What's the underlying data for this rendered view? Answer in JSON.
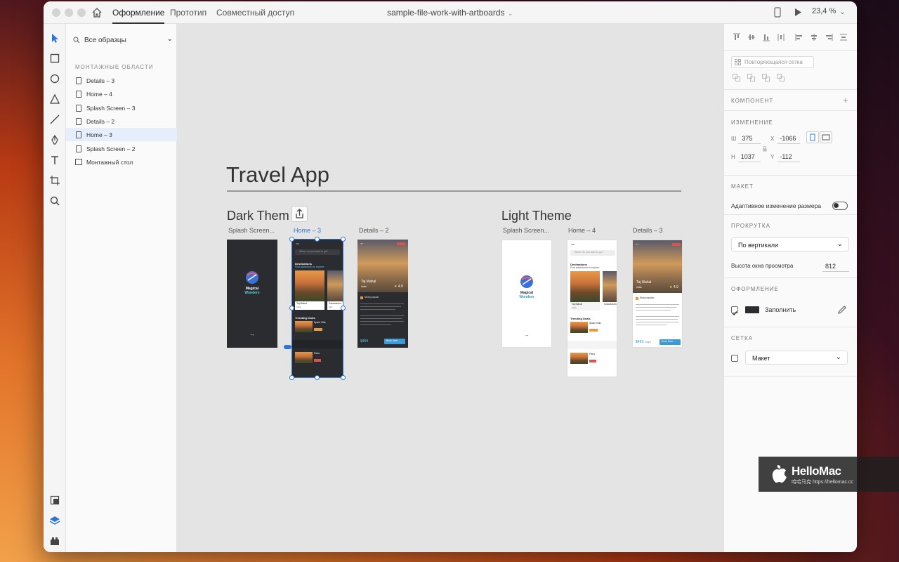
{
  "titlebar": {
    "tabs": [
      "Оформление",
      "Прототип",
      "Совместный доступ"
    ],
    "doc_title": "sample-file-work-with-artboards",
    "zoom": "23,4 %"
  },
  "layers": {
    "sample_select": "Все образцы",
    "section_label": "МОНТАЖНЫЕ ОБЛАСТИ",
    "items": [
      {
        "label": "Details – 3"
      },
      {
        "label": "Home – 4"
      },
      {
        "label": "Splash Screen – 3"
      },
      {
        "label": "Details – 2"
      },
      {
        "label": "Home – 3"
      },
      {
        "label": "Splash Screen – 2"
      },
      {
        "label": "Монтажный стол"
      }
    ],
    "selected_index": 4
  },
  "canvas": {
    "title": "Travel App",
    "dark_theme_title": "Dark Them",
    "light_theme_title": "Light Theme",
    "artboards": [
      {
        "label": "Splash Screen..."
      },
      {
        "label": "Home – 3"
      },
      {
        "label": "Details – 2"
      },
      {
        "label": "Splash Screen..."
      },
      {
        "label": "Home – 4"
      },
      {
        "label": "Details – 3"
      }
    ],
    "splash": {
      "line1": "Magical",
      "line2": "Wonders",
      "arrow": "→"
    },
    "home": {
      "search": "Where do you want to go?",
      "destinations": "Destinations",
      "destinations_sub": "Find adventures to explore",
      "card1": "Taj Mahal",
      "card1_loc": "India",
      "card2": "Colosseum",
      "card2_loc": "Italy",
      "trending": "Trending Deals",
      "deal1": "Spain Villa",
      "deal2": "Paris"
    },
    "details": {
      "place": "Taj Mahal",
      "country": "India",
      "rating": "4.9",
      "most_popular": "Most popular",
      "price": "$499",
      "per": "/night",
      "book": "Book Now →"
    }
  },
  "props": {
    "repeat_grid": "Повторяющаяся сетка",
    "component_label": "КОМПОНЕНТ",
    "transform_label": "ИЗМЕНЕНИЕ",
    "w_key": "Ш",
    "w": "375",
    "x_key": "X",
    "x": "-1066",
    "h_key": "Н",
    "h": "1037",
    "y_key": "Y",
    "y": "-112",
    "layout_label": "МАКЕТ",
    "responsive_resize": "Адаптивное изменение размера",
    "responsive_on": false,
    "scroll_label": "ПРОКРУТКА",
    "scroll_value": "По вертикали",
    "viewport_height_label": "Высота окна просмотра",
    "viewport_height": "812",
    "appearance_label": "ОФОРМЛЕНИЕ",
    "fill_label": "Заполнить",
    "fill_checked": true,
    "fill_color": "#2b2c30",
    "grid_label": "СЕТКА",
    "grid_value": "Макет",
    "grid_checked": false
  },
  "watermark": {
    "name": "HelloMac",
    "url": "哈哈马克 https://hellomac.cc"
  },
  "colors": {
    "accent": "#2d76d8",
    "canvas_bg": "#e4e4e4",
    "dark_artboard": "#2b2c30",
    "button_blue": "#3b9ad9"
  }
}
